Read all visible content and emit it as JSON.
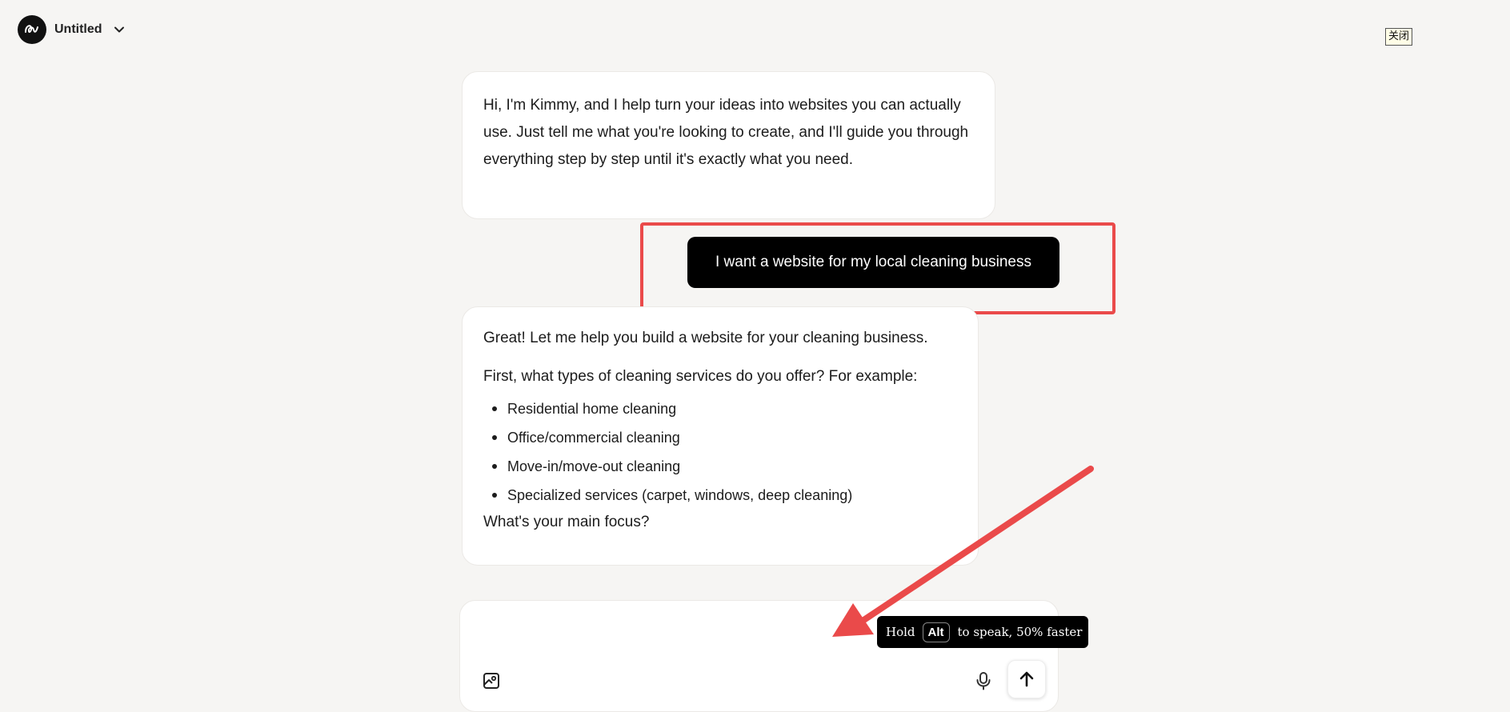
{
  "header": {
    "title": "Untitled",
    "logo_icon": "kimmy-logo-icon",
    "dropdown_icon": "chevron-down-icon"
  },
  "overlay": {
    "close_label": "关闭"
  },
  "messages": [
    {
      "role": "assistant",
      "text": "Hi, I'm Kimmy, and I help turn your ideas into websites you can actually use. Just tell me what you're looking to create, and I'll guide you through everything step by step until it's exactly what you need."
    },
    {
      "role": "user",
      "text": "I want a website for my local cleaning business"
    },
    {
      "role": "assistant",
      "intro": "Great! Let me help you build a website for your cleaning business.",
      "question": "First, what types of cleaning services do you offer? For example:",
      "items": [
        "Residential home cleaning",
        "Office/commercial cleaning",
        "Move-in/move-out cleaning",
        "Specialized services (carpet, windows, deep cleaning)"
      ],
      "closing": "What's your main focus?"
    }
  ],
  "composer": {
    "placeholder": "",
    "image_icon": "image-upload-icon",
    "mic_icon": "microphone-icon",
    "send_icon": "arrow-up-icon"
  },
  "tooltip": {
    "prefix": "Hold",
    "key": "Alt",
    "suffix": "to speak, 50% faster"
  },
  "annotation": {
    "color": "#ea4a4a"
  }
}
